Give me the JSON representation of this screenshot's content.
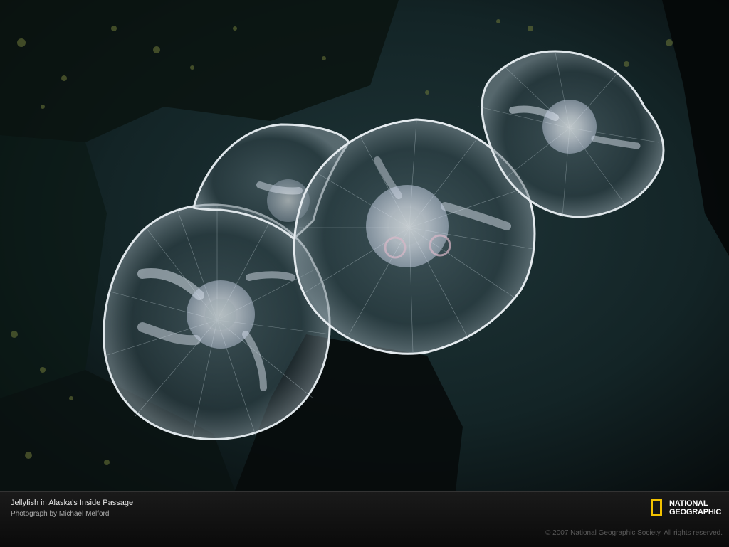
{
  "caption": {
    "title": "Jellyfish in Alaska's Inside Passage",
    "credit": "Photograph by Michael Melford"
  },
  "logo": {
    "line1": "NATIONAL",
    "line2": "GEOGRAPHIC",
    "accent_color": "#f2c200"
  },
  "copyright": "© 2007 National Geographic Society. All rights reserved.",
  "colors": {
    "water_dark": "#0b1415",
    "water_blue": "#1d3236",
    "bell_rim": "#dfe6ea",
    "gonad": "#e9eef8",
    "caption_bg": "#111111"
  }
}
